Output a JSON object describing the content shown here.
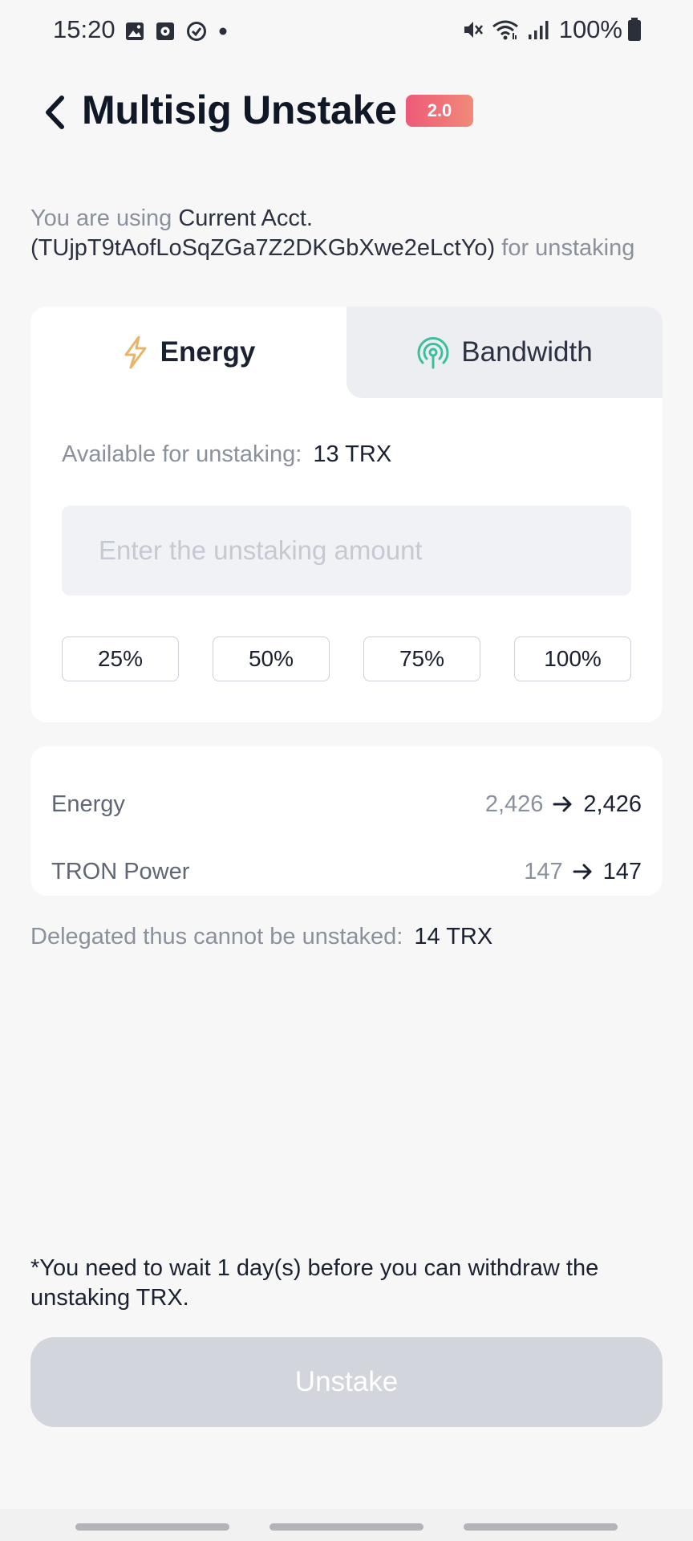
{
  "status_bar": {
    "time": "15:20",
    "battery": "100%",
    "icons_left": [
      "gallery-icon",
      "media-icon",
      "sync-icon",
      "dot-icon"
    ],
    "icons_right": [
      "mute-icon",
      "wifi-icon",
      "signal-icon",
      "battery-icon"
    ]
  },
  "header": {
    "back_icon": "chevron-left-icon",
    "title": "Multisig Unstake",
    "badge": "2.0",
    "badge_color": "#ef5f78"
  },
  "account": {
    "prefix": "You are using",
    "account_text": "Current Acct.(TUjpT9tAofLoSqZGa7Z2DKGbXwe2eLctYo)",
    "suffix": "for unstaking"
  },
  "tabs": [
    {
      "label": "Energy",
      "icon": "lightning-icon",
      "active": true,
      "icon_color": "#e7b46b"
    },
    {
      "label": "Bandwidth",
      "icon": "broadcast-icon",
      "active": false,
      "icon_color": "#3dbf9c"
    }
  ],
  "available": {
    "label": "Available for unstaking:",
    "value": "13 TRX"
  },
  "amount_input": {
    "placeholder": "Enter the unstaking amount",
    "value": ""
  },
  "percent_buttons": [
    "25%",
    "50%",
    "75%",
    "100%"
  ],
  "resources": [
    {
      "label": "Energy",
      "from": "2,426",
      "to": "2,426"
    },
    {
      "label": "TRON Power",
      "from": "147",
      "to": "147"
    }
  ],
  "delegated": {
    "label": "Delegated thus cannot be unstaked:",
    "value": "14 TRX"
  },
  "wait_note": "*You need to wait 1 day(s) before you can withdraw the unstaking TRX.",
  "unstake_button": {
    "label": "Unstake",
    "enabled": false
  }
}
